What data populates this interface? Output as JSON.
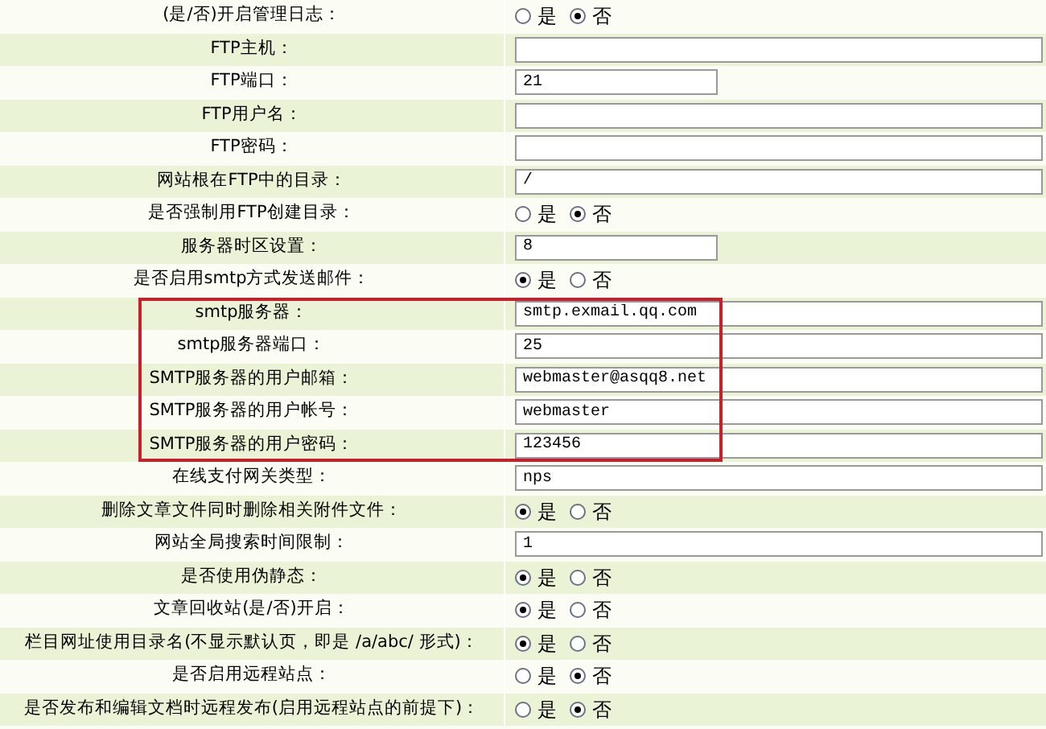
{
  "rows": [
    {
      "label": "(是/否)开启管理日志：",
      "kind": "radio",
      "highlighted": false,
      "options": [
        {
          "label": "是",
          "selected": false
        },
        {
          "label": "否",
          "selected": true
        }
      ]
    },
    {
      "label": "FTP主机：",
      "kind": "text",
      "highlighted": false
    },
    {
      "label": "FTP端口：",
      "kind": "short_text",
      "highlighted": false,
      "value": "21"
    },
    {
      "label": "FTP用户名：",
      "kind": "text",
      "highlighted": false
    },
    {
      "label": "FTP密码：",
      "kind": "text",
      "highlighted": false
    },
    {
      "label": "网站根在FTP中的目录：",
      "kind": "text",
      "highlighted": false,
      "value": "/"
    },
    {
      "label": "是否强制用FTP创建目录：",
      "kind": "radio",
      "highlighted": false,
      "options": [
        {
          "label": "是",
          "selected": false
        },
        {
          "label": "否",
          "selected": true
        }
      ]
    },
    {
      "label": "服务器时区设置：",
      "kind": "short_text",
      "highlighted": false,
      "value": "8"
    },
    {
      "label": "是否启用smtp方式发送邮件：",
      "kind": "radio",
      "highlighted": false,
      "options": [
        {
          "label": "是",
          "selected": true
        },
        {
          "label": "否",
          "selected": false
        }
      ]
    },
    {
      "label": "smtp服务器：",
      "kind": "text",
      "highlighted": true,
      "value": "smtp.exmail.qq.com"
    },
    {
      "label": "smtp服务器端口：",
      "kind": "text",
      "highlighted": true,
      "value": "25"
    },
    {
      "label": "SMTP服务器的用户邮箱：",
      "kind": "text",
      "highlighted": true,
      "value": "webmaster@asqq8.net"
    },
    {
      "label": "SMTP服务器的用户帐号：",
      "kind": "text",
      "highlighted": true,
      "value": "webmaster"
    },
    {
      "label": "SMTP服务器的用户密码：",
      "kind": "text",
      "highlighted": true,
      "value": "123456"
    },
    {
      "label": "在线支付网关类型：",
      "kind": "text",
      "highlighted": false,
      "value": "nps"
    },
    {
      "label": "删除文章文件同时删除相关附件文件：",
      "kind": "radio",
      "highlighted": false,
      "options": [
        {
          "label": "是",
          "selected": true
        },
        {
          "label": "否",
          "selected": false
        }
      ]
    },
    {
      "label": "网站全局搜索时间限制：",
      "kind": "text",
      "highlighted": false,
      "value": "1"
    },
    {
      "label": "是否使用伪静态：",
      "kind": "radio",
      "highlighted": false,
      "options": [
        {
          "label": "是",
          "selected": true
        },
        {
          "label": "否",
          "selected": false
        }
      ]
    },
    {
      "label": "文章回收站(是/否)开启：",
      "kind": "radio",
      "highlighted": false,
      "options": [
        {
          "label": "是",
          "selected": true
        },
        {
          "label": "否",
          "selected": false
        }
      ]
    },
    {
      "label": "栏目网址使用目录名(不显示默认页，即是 /a/abc/ 形式)：",
      "kind": "radio",
      "highlighted": false,
      "options": [
        {
          "label": "是",
          "selected": true
        },
        {
          "label": "否",
          "selected": false
        }
      ]
    },
    {
      "label": "是否启用远程站点：",
      "kind": "radio",
      "highlighted": false,
      "options": [
        {
          "label": "是",
          "selected": false
        },
        {
          "label": "否",
          "selected": true
        }
      ]
    },
    {
      "label": "是否发布和编辑文档时远程发布(启用远程站点的前提下)：",
      "kind": "radio",
      "highlighted": false,
      "options": [
        {
          "label": "是",
          "selected": false
        },
        {
          "label": "否",
          "selected": true
        }
      ]
    }
  ]
}
